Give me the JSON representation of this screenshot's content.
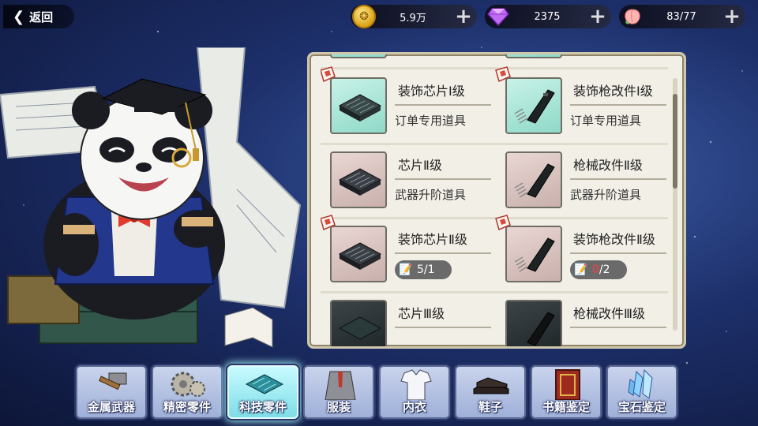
{
  "header": {
    "back_label": "返回",
    "resources": [
      {
        "icon": "gold-coin-icon",
        "value": "5.9万"
      },
      {
        "icon": "purple-gem-icon",
        "value": "2375"
      },
      {
        "icon": "peach-stamina-icon",
        "value": "83/77"
      }
    ]
  },
  "inventory": {
    "rows": [
      [
        {
          "name": "装饰芯片Ⅰ级",
          "desc": "订单专用道具",
          "icon": "chip-icon",
          "bg": "teal",
          "badge": true
        },
        {
          "name": "装饰枪改件Ⅰ级",
          "desc": "订单专用道具",
          "icon": "gun-part-icon",
          "bg": "teal",
          "badge": true
        }
      ],
      [
        {
          "name": "芯片Ⅱ级",
          "desc": "武器升阶道具",
          "icon": "chip-icon",
          "bg": "pink",
          "badge": false
        },
        {
          "name": "枪械改件Ⅱ级",
          "desc": "武器升阶道具",
          "icon": "gun-part-icon",
          "bg": "pink",
          "badge": false
        }
      ],
      [
        {
          "name": "装饰芯片Ⅱ级",
          "count": "5/1",
          "icon": "chip-icon",
          "bg": "pink",
          "badge": true
        },
        {
          "name": "装饰枪改件Ⅱ级",
          "count_have": "0",
          "count_need": "/2",
          "icon": "gun-part-icon",
          "bg": "pink",
          "badge": true
        }
      ],
      [
        {
          "name": "芯片Ⅲ级",
          "icon": "chip-icon",
          "bg": "dark",
          "badge": false
        },
        {
          "name": "枪械改件Ⅲ级",
          "icon": "gun-part-icon",
          "bg": "dark",
          "badge": false
        }
      ]
    ]
  },
  "tabs": [
    {
      "label": "金属武器",
      "icon": "hammer-icon",
      "active": false
    },
    {
      "label": "精密零件",
      "icon": "gear-icon",
      "active": false
    },
    {
      "label": "科技零件",
      "icon": "tech-chip-icon",
      "active": true
    },
    {
      "label": "服装",
      "icon": "suit-icon",
      "active": false
    },
    {
      "label": "内衣",
      "icon": "shirt-icon",
      "active": false
    },
    {
      "label": "鞋子",
      "icon": "shoes-icon",
      "active": false
    },
    {
      "label": "书籍鉴定",
      "icon": "book-icon",
      "active": false
    },
    {
      "label": "宝石鉴定",
      "icon": "crystal-icon",
      "active": false
    }
  ],
  "colors": {
    "background": "#1d2f6a",
    "panel": "#f2efe6",
    "active_tab": "#7fdde8",
    "insufficient": "#ff3b3b"
  }
}
